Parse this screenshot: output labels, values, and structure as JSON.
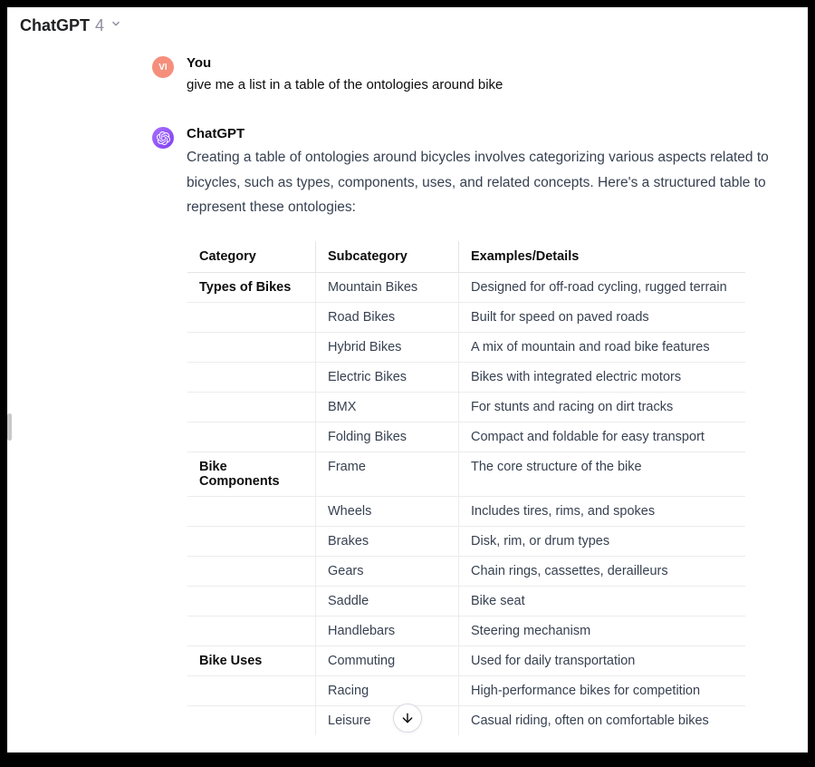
{
  "header": {
    "model_name": "ChatGPT",
    "model_version": "4"
  },
  "user_message": {
    "avatar_initials": "VI",
    "sender": "You",
    "text": "give me a list in a table of the ontologies around bike"
  },
  "assistant_message": {
    "sender": "ChatGPT",
    "intro": "Creating a table of ontologies around bicycles involves categorizing various aspects related to bicycles, such as types, components, uses, and related concepts. Here's a structured table to represent these ontologies:",
    "table": {
      "headers": [
        "Category",
        "Subcategory",
        "Examples/Details"
      ],
      "rows": [
        {
          "cat": "Types of Bikes",
          "sub": "Mountain Bikes",
          "det": "Designed for off-road cycling, rugged terrain"
        },
        {
          "cat": "",
          "sub": "Road Bikes",
          "det": "Built for speed on paved roads"
        },
        {
          "cat": "",
          "sub": "Hybrid Bikes",
          "det": "A mix of mountain and road bike features"
        },
        {
          "cat": "",
          "sub": "Electric Bikes",
          "det": "Bikes with integrated electric motors"
        },
        {
          "cat": "",
          "sub": "BMX",
          "det": "For stunts and racing on dirt tracks"
        },
        {
          "cat": "",
          "sub": "Folding Bikes",
          "det": "Compact and foldable for easy transport"
        },
        {
          "cat": "Bike Components",
          "sub": "Frame",
          "det": "The core structure of the bike"
        },
        {
          "cat": "",
          "sub": "Wheels",
          "det": "Includes tires, rims, and spokes"
        },
        {
          "cat": "",
          "sub": "Brakes",
          "det": "Disk, rim, or drum types"
        },
        {
          "cat": "",
          "sub": "Gears",
          "det": "Chain rings, cassettes, derailleurs"
        },
        {
          "cat": "",
          "sub": "Saddle",
          "det": "Bike seat"
        },
        {
          "cat": "",
          "sub": "Handlebars",
          "det": "Steering mechanism"
        },
        {
          "cat": "Bike Uses",
          "sub": "Commuting",
          "det": "Used for daily transportation"
        },
        {
          "cat": "",
          "sub": "Racing",
          "det": "High-performance bikes for competition"
        },
        {
          "cat": "",
          "sub": "Leisure",
          "det": "Casual riding, often on comfortable bikes"
        }
      ]
    }
  }
}
